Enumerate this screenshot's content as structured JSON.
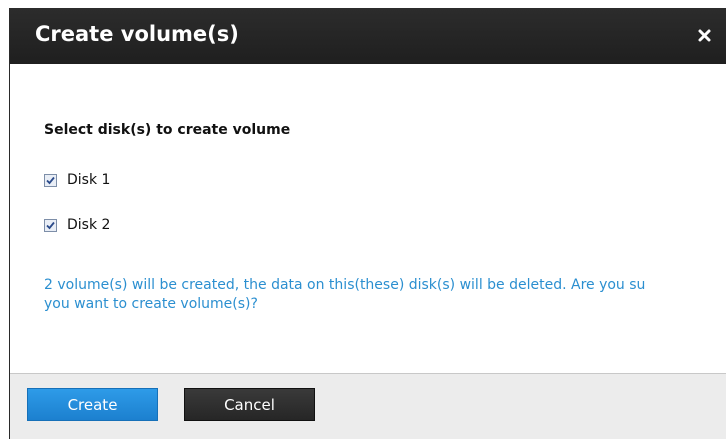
{
  "dialog": {
    "title": "Create volume(s)",
    "close_icon": "close-icon",
    "close_glyph": "×"
  },
  "content": {
    "heading": "Select disk(s) to create volume",
    "disks": [
      {
        "label": "Disk 1",
        "checked": true
      },
      {
        "label": "Disk 2",
        "checked": true
      }
    ],
    "warning_line1": "2 volume(s) will be created, the data on this(these) disk(s) will be deleted. Are you su",
    "warning_line2": "you want to create volume(s)?"
  },
  "footer": {
    "create_label": "Create",
    "cancel_label": "Cancel"
  },
  "colors": {
    "titlebar": "#2a2a2a",
    "primary_button": "#2492e0",
    "secondary_button": "#2e2e2e",
    "warning_text": "#2b8fd0",
    "footer_bg": "#ececec"
  }
}
